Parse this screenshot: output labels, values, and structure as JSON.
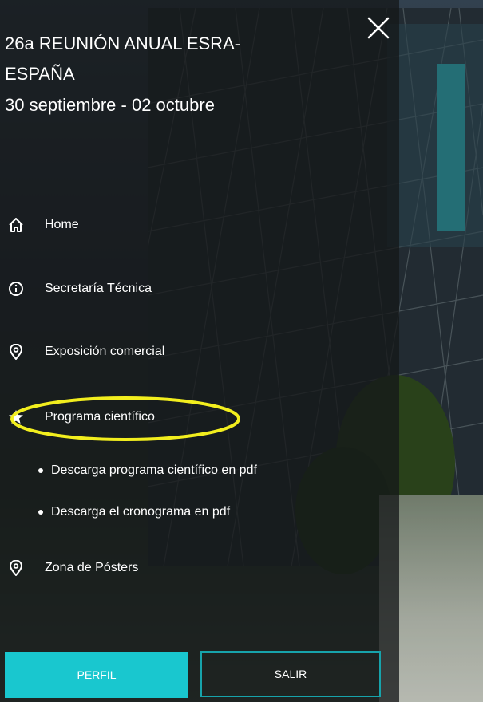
{
  "menu": {
    "event_title": "26a REUNIÓN ANUAL ESRA-ESPAÑA",
    "event_dates": "30 septiembre - 02 octubre",
    "items": [
      {
        "label": "Home",
        "icon": "home-icon"
      },
      {
        "label": "Secretaría Técnica",
        "icon": "info-icon"
      },
      {
        "label": "Exposición comercial",
        "icon": "location-pin-icon"
      },
      {
        "label": "Programa científico",
        "icon": "star-icon",
        "highlighted": true
      },
      {
        "label": "Zona de Pósters",
        "icon": "location-pin-icon"
      }
    ],
    "subitems": [
      {
        "label": "Descarga programa científico en pdf"
      },
      {
        "label": "Descarga el cronograma en pdf"
      }
    ],
    "buttons": {
      "perfil": "PERFIL",
      "salir": "SALIR"
    }
  },
  "colors": {
    "overlay": "#141618",
    "accent_teal": "#19c7cf",
    "outline_teal": "#17a3ab",
    "highlight_yellow": "#f2ee1e",
    "text": "#ffffff"
  }
}
